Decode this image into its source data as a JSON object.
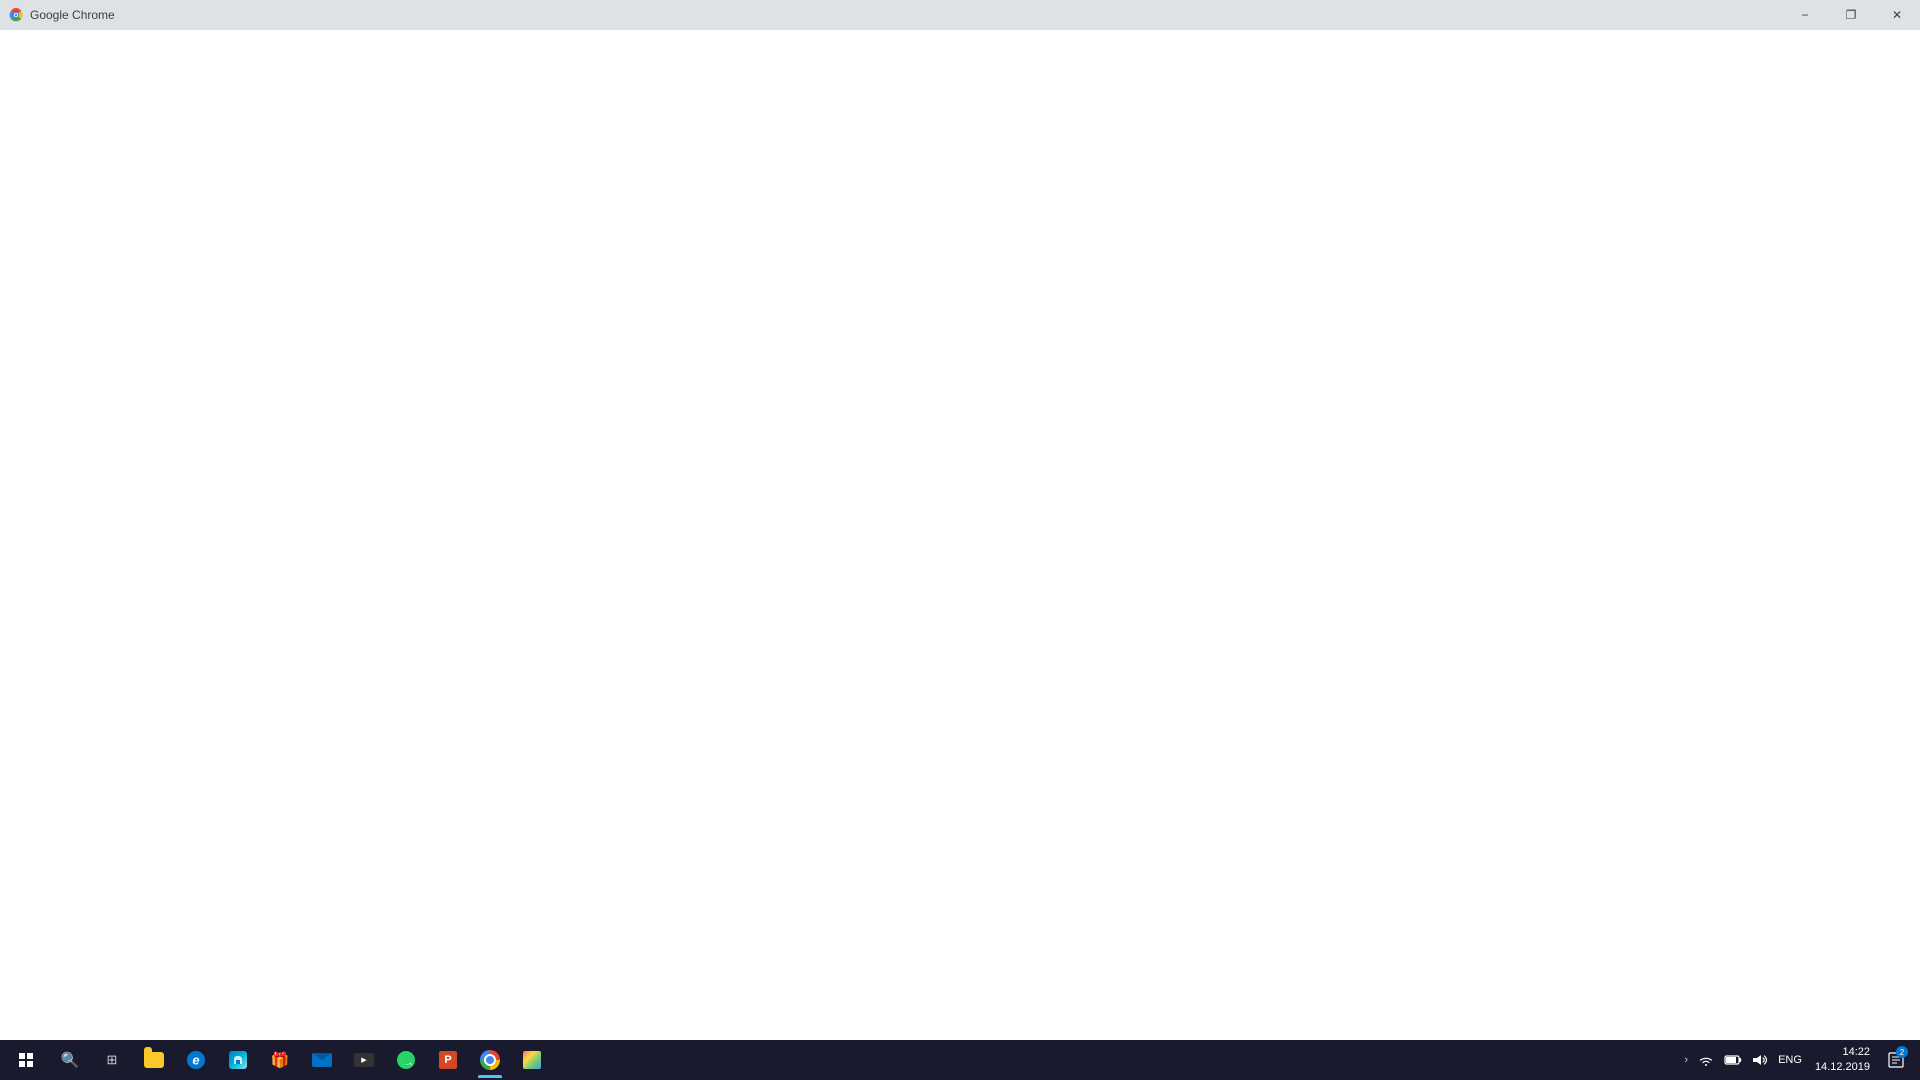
{
  "titlebar": {
    "title": "Google Chrome",
    "minimize_label": "−",
    "maximize_label": "❐",
    "close_label": "✕"
  },
  "taskbar": {
    "start_button_label": "Start",
    "search_placeholder": "Search",
    "time": "14:22",
    "date": "14.12.2019",
    "language": "ENG",
    "notification_count": "2",
    "apps": [
      {
        "name": "Windows Start",
        "type": "start"
      },
      {
        "name": "Search",
        "type": "search"
      },
      {
        "name": "Task View",
        "type": "taskview"
      },
      {
        "name": "File Explorer",
        "type": "folder"
      },
      {
        "name": "Microsoft Edge",
        "type": "edge"
      },
      {
        "name": "Microsoft Store",
        "type": "store"
      },
      {
        "name": "My People / Gift",
        "type": "gift"
      },
      {
        "name": "Mail",
        "type": "mail"
      },
      {
        "name": "Movies & TV",
        "type": "video"
      },
      {
        "name": "WhatsApp",
        "type": "whatsapp"
      },
      {
        "name": "PowerPoint",
        "type": "powerpoint"
      },
      {
        "name": "Google Chrome",
        "type": "chrome",
        "active": true
      },
      {
        "name": "Photos",
        "type": "photos"
      }
    ],
    "tray_icons": [
      {
        "name": "chevron",
        "symbol": "‹"
      },
      {
        "name": "wifi",
        "symbol": "📶"
      },
      {
        "name": "battery",
        "symbol": "🔋"
      },
      {
        "name": "volume",
        "symbol": "🔊"
      }
    ]
  }
}
